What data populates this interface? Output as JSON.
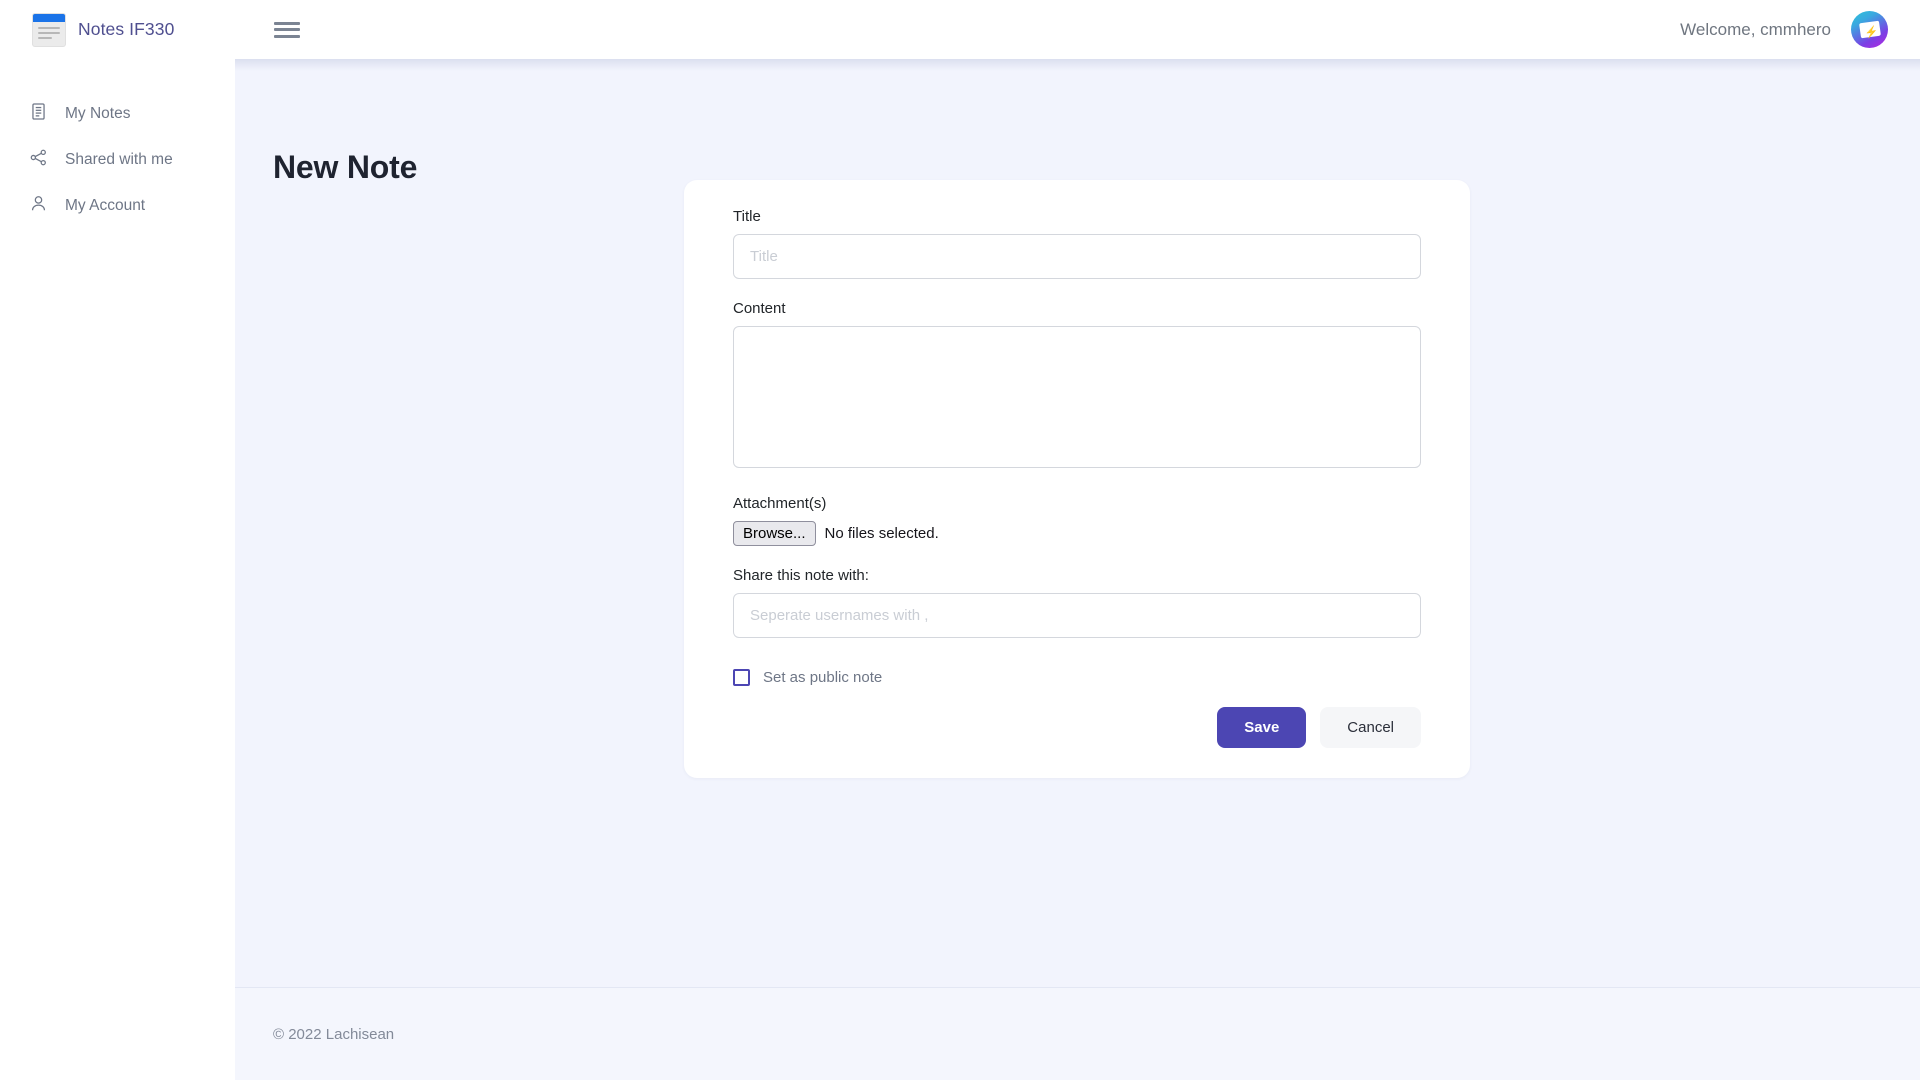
{
  "navbar": {
    "brand_name": "Notes IF330",
    "logo_icon": "document-logo-icon",
    "menu_icon": "hamburger-menu-icon",
    "welcome_text": "Welcome, cmmhero",
    "avatar_icon": "user-avatar-icon"
  },
  "sidebar": {
    "items": [
      {
        "label": "My Notes",
        "icon": "notes-document-icon"
      },
      {
        "label": "Shared with me",
        "icon": "share-nodes-icon"
      },
      {
        "label": "My Account",
        "icon": "user-person-icon"
      }
    ]
  },
  "main": {
    "page_title": "New Note"
  },
  "form": {
    "title_label": "Title",
    "title_value": "",
    "title_placeholder": "Title",
    "content_label": "Content",
    "content_value": "",
    "content_placeholder": "",
    "attachments_label": "Attachment(s)",
    "browse_button": "Browse...",
    "file_status": "No files selected.",
    "share_label": "Share this note with:",
    "share_value": "",
    "share_placeholder": "Seperate usernames with ,",
    "public_note_label": "Set as public note",
    "public_note_checked": false,
    "save_label": "Save",
    "cancel_label": "Cancel"
  },
  "footer": {
    "copyright": "© 2022 Lachisean"
  },
  "colors": {
    "accent_purple": "#4c46b3",
    "brand_text": "#4f4f8f",
    "page_bg": "#f2f4fd",
    "logo_blue": "#1a73e8"
  }
}
